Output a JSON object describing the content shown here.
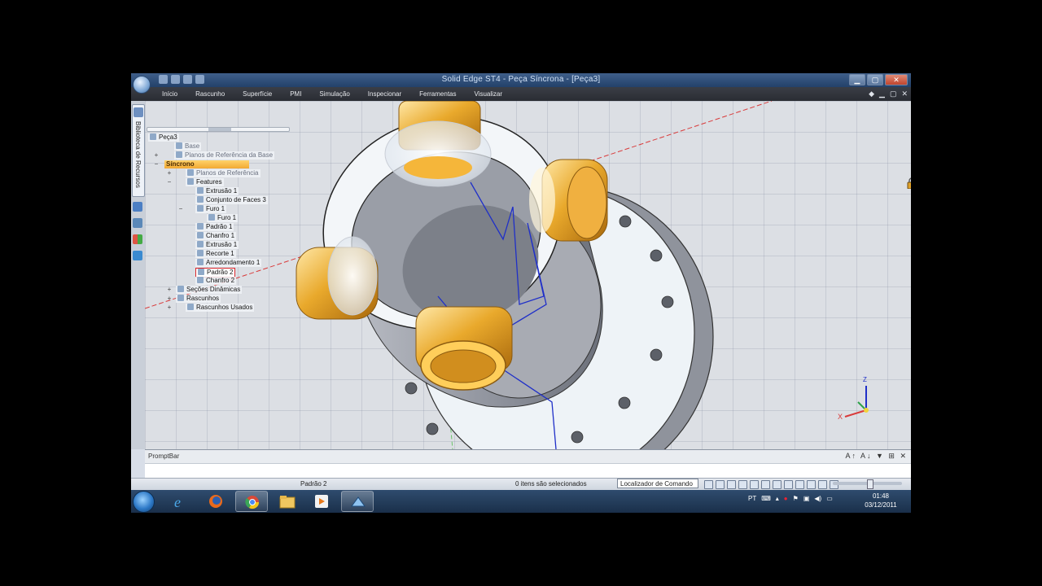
{
  "window": {
    "title": "Solid Edge ST4 - Peça Síncrona - [Peça3]",
    "controls": {
      "minimize": "▁",
      "maximize": "▢",
      "close": "✕"
    }
  },
  "menu": {
    "items": [
      "Início",
      "Rascunho",
      "Superfície",
      "PMI",
      "Simulação",
      "Inspecionar",
      "Ferramentas",
      "Visualizar"
    ],
    "right_controls": [
      "◆",
      "▁",
      "▢",
      "✕"
    ]
  },
  "side_tab": {
    "label": "Biblioteca de Recursos"
  },
  "tree": {
    "nodes": [
      {
        "label": "Peça3"
      },
      {
        "label": "Base"
      },
      {
        "label": "Planos de Referência da Base"
      },
      {
        "label": "Síncrono"
      },
      {
        "label": "Planos de Referência"
      },
      {
        "label": "Features"
      },
      {
        "label": "Extrusão 1"
      },
      {
        "label": "Conjunto de Faces 3"
      },
      {
        "label": "Furo 1"
      },
      {
        "label": "Furo 1"
      },
      {
        "label": "Padrão 1"
      },
      {
        "label": "Chanfro 1"
      },
      {
        "label": "Extrusão 1"
      },
      {
        "label": "Recorte 1"
      },
      {
        "label": "Arredondamento 1"
      },
      {
        "label": "Padrão 2"
      },
      {
        "label": "Chanfro 2"
      },
      {
        "label": "Seções Dinâmicas"
      },
      {
        "label": "Rascunhos"
      },
      {
        "label": "Rascunhos Usados"
      }
    ],
    "selected": "Síncrono",
    "highlighted": "Padrão 2"
  },
  "triad": {
    "z": "Z",
    "x": "X"
  },
  "promptbar": {
    "title": "PromptBar",
    "controls": "A↑ A↓ ▼ ⊞ ✕"
  },
  "status": {
    "selected_feature": "Padrão 2",
    "count": "0 itens são selecionados",
    "locator": "Localizador de Comando"
  },
  "taskbar": {
    "apps": [
      "start-orb",
      "internet-explorer",
      "firefox",
      "chrome",
      "file-explorer",
      "media-player",
      "solid-edge"
    ],
    "lang": "PT",
    "time": "01:48",
    "date": "03/12/2011"
  },
  "colors": {
    "accent_orange": "#f2a933",
    "boss_gold": "#e0a22a",
    "sketch_blue": "#1f2fc8",
    "axis_red": "#d93a3a"
  }
}
